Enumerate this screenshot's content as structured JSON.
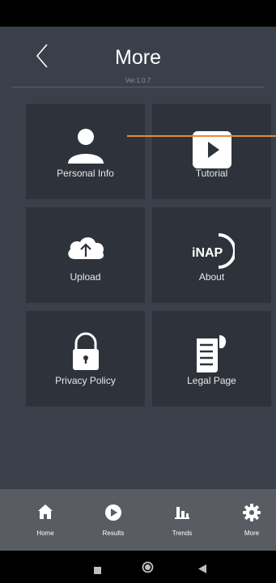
{
  "header": {
    "title": "More",
    "version": "Ver.1.0.7"
  },
  "tiles": [
    {
      "id": "personal",
      "label": "Personal Info",
      "icon": "person-icon"
    },
    {
      "id": "tutorial",
      "label": "Tutorial",
      "icon": "play-icon"
    },
    {
      "id": "upload",
      "label": "Upload",
      "icon": "cloud-upload-icon"
    },
    {
      "id": "about",
      "label": "About",
      "icon": "inap-logo-icon",
      "logo_text": "iNAP"
    },
    {
      "id": "privacy",
      "label": "Privacy Policy",
      "icon": "lock-icon"
    },
    {
      "id": "legal",
      "label": "Legal Page",
      "icon": "document-icon"
    }
  ],
  "tab_bar": {
    "items": [
      {
        "label": "Home",
        "icon": "home-icon"
      },
      {
        "label": "Results",
        "icon": "play-circle-icon"
      },
      {
        "label": "Trends",
        "icon": "bar-chart-icon"
      },
      {
        "label": "More",
        "icon": "gear-icon"
      }
    ]
  },
  "colors": {
    "background": "#3a4049",
    "tile": "#2e333b",
    "tab_bar": "#595d63",
    "accent_line": "#e8893a"
  }
}
